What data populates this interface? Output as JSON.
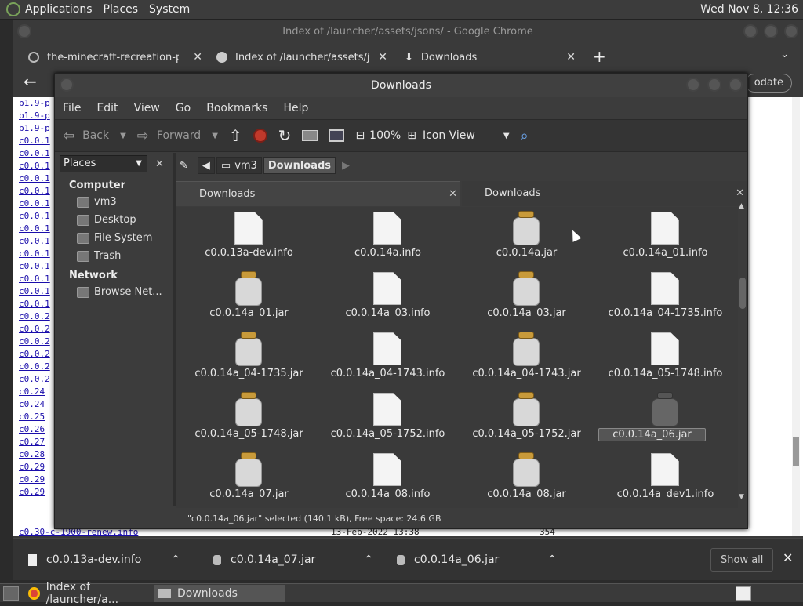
{
  "topbar": {
    "menus": [
      "Applications",
      "Places",
      "System"
    ],
    "clock": "Wed Nov 8, 12:36"
  },
  "chrome": {
    "title": "Index of /launcher/assets/jsons/ - Google Chrome",
    "tabs": [
      "the-minecraft-recreation-proj",
      "Index of /launcher/assets/jsons/",
      "Downloads"
    ],
    "new_tab": "+",
    "update_label": "odate",
    "listing": [
      "b1.9-p",
      "b1.9-p",
      "b1.9-p",
      "c0.0.1",
      "c0.0.1",
      "c0.0.1",
      "c0.0.1",
      "c0.0.1",
      "c0.0.1",
      "c0.0.1",
      "c0.0.1",
      "c0.0.1",
      "c0.0.1",
      "c0.0.1",
      "c0.0.1",
      "c0.0.1",
      "c0.0.1",
      "c0.0.2",
      "c0.0.2",
      "c0.0.2",
      "c0.0.2",
      "c0.0.2",
      "c0.0.2",
      "c0.24",
      "c0.24",
      "c0.25",
      "c0.26",
      "c0.27",
      "c0.28",
      "c0.29",
      "c0.29",
      "c0.29"
    ],
    "last_row": {
      "name": "c0.30-c-1900-renew.info",
      "date": "13-Feb-2022 13:38",
      "size": "354"
    }
  },
  "downloads_bar": {
    "items": [
      "c0.0.13a-dev.info",
      "c0.0.14a_07.jar",
      "c0.0.14a_06.jar"
    ],
    "show_all": "Show all"
  },
  "taskbar": {
    "items": [
      "Index of /launcher/a...",
      "Downloads"
    ]
  },
  "fm": {
    "title": "Downloads",
    "menus": [
      "File",
      "Edit",
      "View",
      "Go",
      "Bookmarks",
      "Help"
    ],
    "toolbar": {
      "back": "Back",
      "forward": "Forward",
      "zoom": "100%",
      "view": "Icon View"
    },
    "sidebar": {
      "selector": "Places",
      "computer_heading": "Computer",
      "computer_items": [
        "vm3",
        "Desktop",
        "File System",
        "Trash"
      ],
      "network_heading": "Network",
      "network_items": [
        "Browse Net..."
      ]
    },
    "path": {
      "parent": "vm3",
      "current": "Downloads"
    },
    "tabs": [
      "Downloads",
      "Downloads"
    ],
    "files": [
      {
        "name": "c0.0.13a-dev.info",
        "type": "doc"
      },
      {
        "name": "c0.0.14a.info",
        "type": "doc"
      },
      {
        "name": "c0.0.14a.jar",
        "type": "jar"
      },
      {
        "name": "c0.0.14a_01.info",
        "type": "doc"
      },
      {
        "name": "c0.0.14a_01.jar",
        "type": "jar"
      },
      {
        "name": "c0.0.14a_03.info",
        "type": "doc"
      },
      {
        "name": "c0.0.14a_03.jar",
        "type": "jar"
      },
      {
        "name": "c0.0.14a_04-1735.info",
        "type": "doc"
      },
      {
        "name": "c0.0.14a_04-1735.jar",
        "type": "jar"
      },
      {
        "name": "c0.0.14a_04-1743.info",
        "type": "doc"
      },
      {
        "name": "c0.0.14a_04-1743.jar",
        "type": "jar"
      },
      {
        "name": "c0.0.14a_05-1748.info",
        "type": "doc"
      },
      {
        "name": "c0.0.14a_05-1748.jar",
        "type": "jar"
      },
      {
        "name": "c0.0.14a_05-1752.info",
        "type": "doc"
      },
      {
        "name": "c0.0.14a_05-1752.jar",
        "type": "jar"
      },
      {
        "name": "c0.0.14a_06.jar",
        "type": "jar-selected"
      },
      {
        "name": "c0.0.14a_07.jar",
        "type": "jar"
      },
      {
        "name": "c0.0.14a_08.info",
        "type": "doc"
      },
      {
        "name": "c0.0.14a_08.jar",
        "type": "jar"
      },
      {
        "name": "c0.0.14a_dev1.info",
        "type": "doc"
      }
    ],
    "status": "\"c0.0.14a_06.jar\" selected (140.1 kB), Free space: 24.6 GB"
  }
}
